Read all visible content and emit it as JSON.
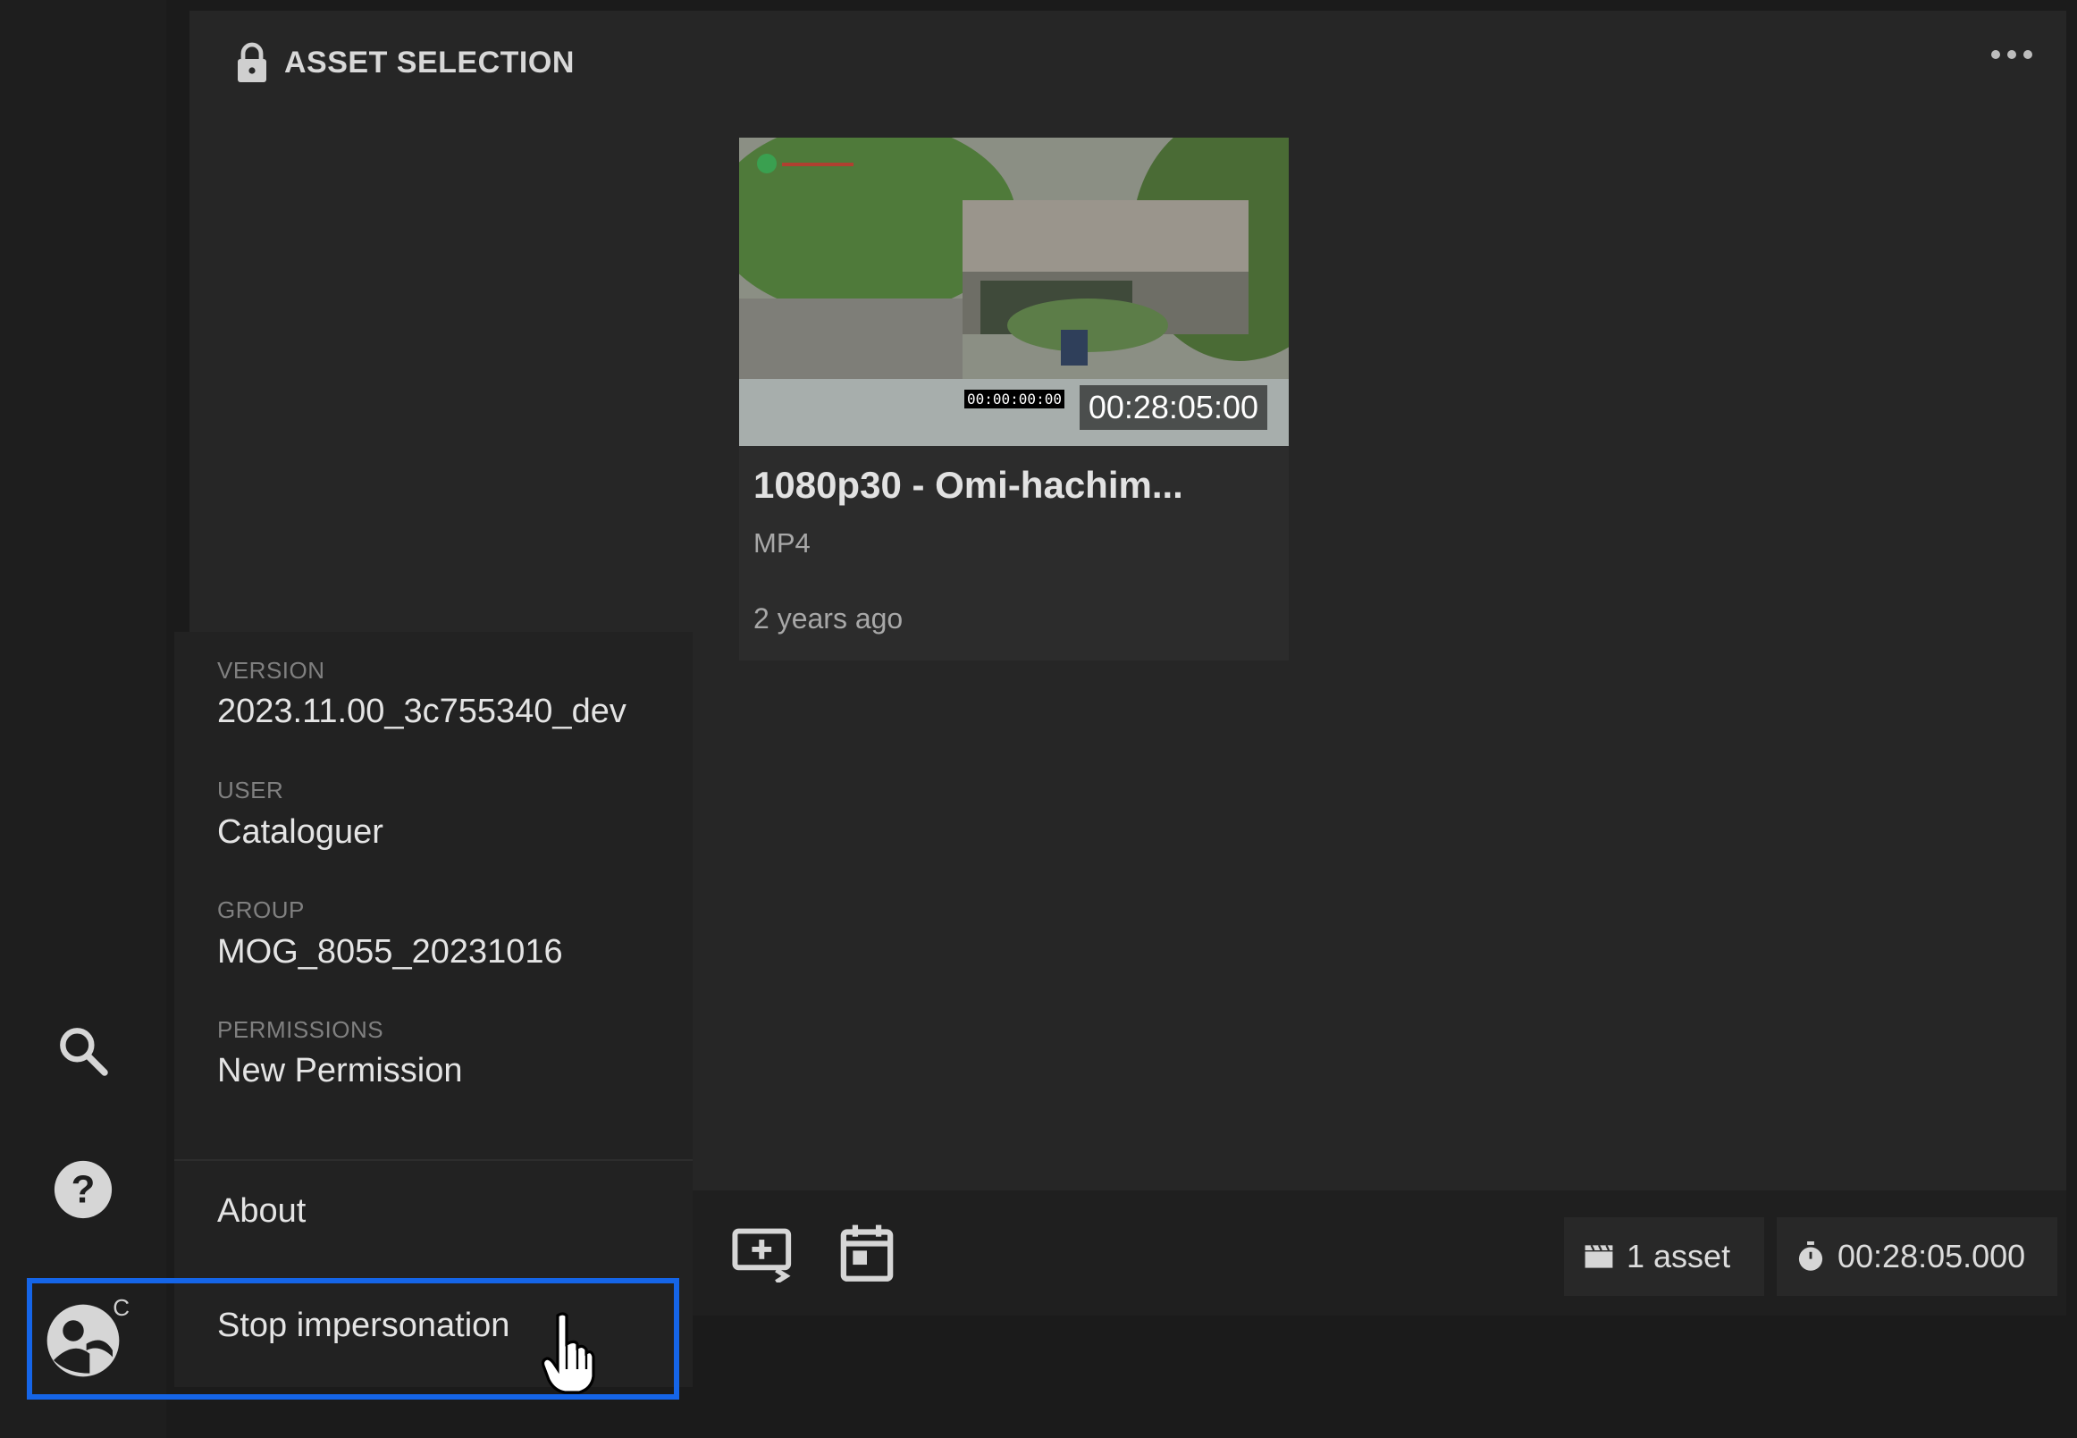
{
  "panel": {
    "title": "ASSET SELECTION",
    "lock_icon": "lock-icon",
    "more_icon": "more-horizontal-icon"
  },
  "asset": {
    "name": "1080p30 - Omi-hachim...",
    "format": "MP4",
    "age": "2 years ago",
    "duration": "00:28:05:00",
    "burned_timecode": "00:00:00:00"
  },
  "user_menu": {
    "version_label": "VERSION",
    "version_value": "2023.11.00_3c755340_dev",
    "user_label": "USER",
    "user_value": "Cataloguer",
    "group_label": "GROUP",
    "group_value": "MOG_8055_20231016",
    "permissions_label": "PERMISSIONS",
    "permissions_value": "New Permission",
    "about": "About",
    "stop_impersonation": "Stop impersonation"
  },
  "sidebar": {
    "avatar_letter": "C",
    "icons": [
      "search-icon",
      "help-icon",
      "impersonate-avatar-icon"
    ]
  },
  "footer": {
    "asset_count": "1 asset",
    "total_duration": "00:28:05.000"
  },
  "colors": {
    "accent_highlight": "#1565e8",
    "panel_bg": "#262626",
    "sidebar_bg": "#1e1e1e"
  }
}
